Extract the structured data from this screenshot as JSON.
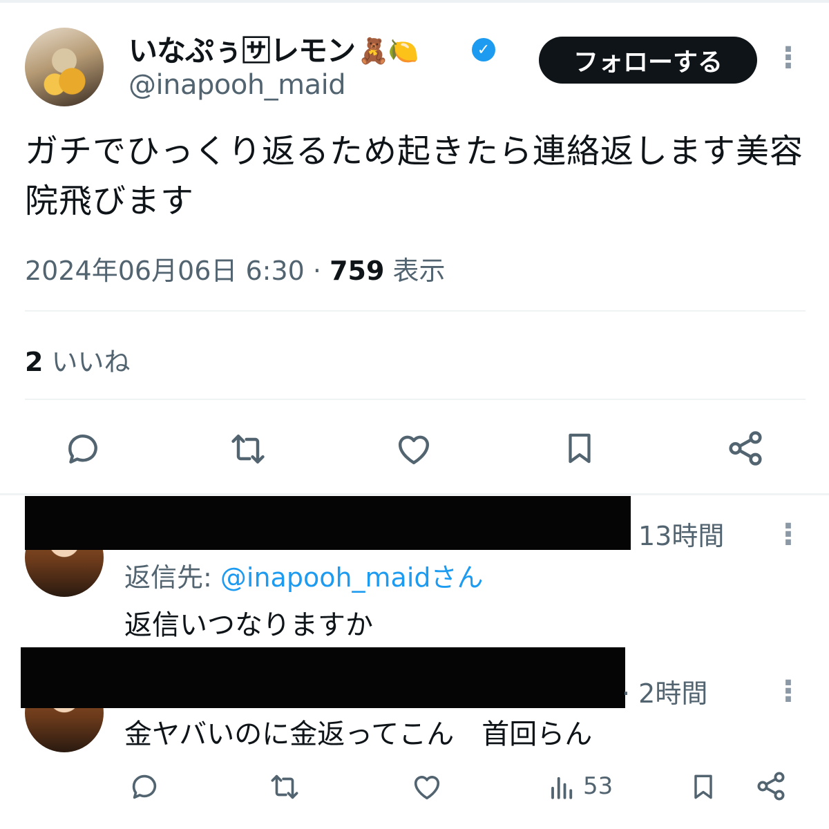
{
  "tweet": {
    "display_name": "いなぷぅ🈂レモン",
    "name_emoji": "🧸🍋",
    "verified_mark": "✓",
    "handle": "@inapooh_maid",
    "follow_label": "フォローする",
    "text": "ガチでひっくり返るため起きたら連絡返します美容院飛びます",
    "date": "2024年06月06日 6:30",
    "separator": "·",
    "views_count": "759",
    "views_label": "表示",
    "likes_count": "2",
    "likes_label": "いいね",
    "icons": [
      "reply-icon",
      "retweet-icon",
      "like-icon",
      "bookmark-icon",
      "share-icon"
    ]
  },
  "replies": [
    {
      "time": "13時間",
      "reply_to_label": "返信先: ",
      "reply_to_user": "@inapooh_maid",
      "reply_to_suffix": "さん",
      "text": "返信いつなりますか"
    },
    {
      "time": "· 2時間",
      "text": "金ヤバいのに金返ってこん　首回らん",
      "views": "53"
    }
  ],
  "colors": {
    "accent": "#1d9bf0",
    "text": "#0f1419",
    "muted": "#536471",
    "divider": "#eff3f4",
    "button": "#0f1419"
  }
}
